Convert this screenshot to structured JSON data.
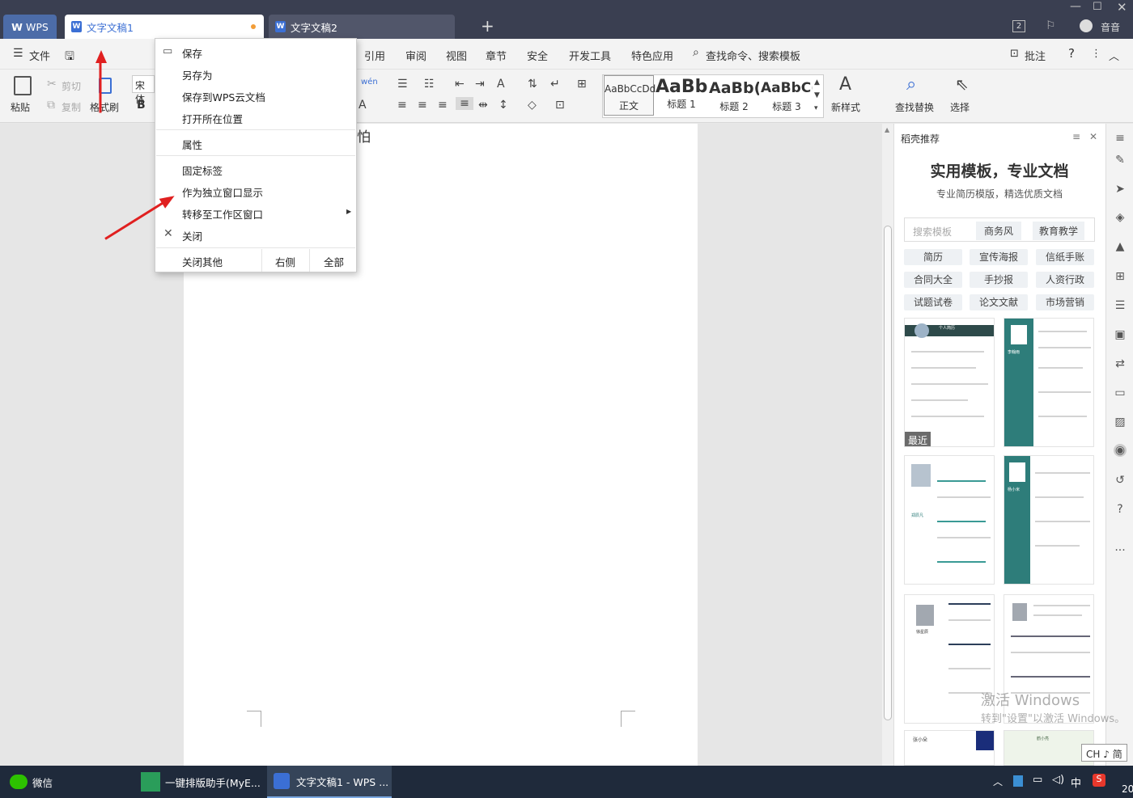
{
  "titlebar": {
    "wps_tab": "WPS",
    "tabs": [
      {
        "label": "文字文稿1"
      },
      {
        "label": "文字文稿2"
      }
    ],
    "new_tab": "+",
    "badge": "2",
    "user_name": "音音"
  },
  "menubar": {
    "items": [
      "文件",
      "引用",
      "审阅",
      "视图",
      "章节",
      "安全",
      "开发工具",
      "特色应用"
    ],
    "search": "查找命令、搜索模板",
    "comment": "批注",
    "help": "?"
  },
  "ribbon": {
    "paste": "粘贴",
    "cut": "剪切",
    "copy": "复制",
    "format_painter": "格式刷",
    "font": "宋体",
    "bold": "B",
    "phonetic": "wén",
    "styles": [
      {
        "preview": "AaBbCcDd",
        "label": "正文"
      },
      {
        "preview": "AaBb",
        "label": "标题 1"
      },
      {
        "preview": "AaBb(",
        "label": "标题 2"
      },
      {
        "preview": "AaBbC(",
        "label": "标题 3"
      }
    ],
    "new_style": "新样式",
    "find_replace": "查找替换",
    "select": "选择"
  },
  "document": {
    "visible_text": "怕"
  },
  "context_menu": {
    "items": [
      "保存",
      "另存为",
      "保存到WPS云文档",
      "打开所在位置",
      "属性",
      "固定标签",
      "作为独立窗口显示",
      "转移至工作区窗口",
      "关闭"
    ],
    "close_others": "关闭其他",
    "right_side": "右侧",
    "all": "全部"
  },
  "panel": {
    "title": "稻壳推荐",
    "headline": "实用模板，专业文档",
    "subline": "专业简历模版，精选优质文档",
    "search_placeholder": "搜索模板",
    "search_tags": [
      "商务风",
      "教育教学"
    ],
    "categories": [
      "简历",
      "宣传海报",
      "信纸手账",
      "合同大全",
      "手抄报",
      "人资行政",
      "试题试卷",
      "论文文献",
      "市场营销"
    ],
    "recent_badge": "最近",
    "thumb_names": [
      "个人简历",
      "李翰雨",
      "郑辰凡",
      "杨小米",
      "徐星辰",
      "张小朵",
      "鹤小亮"
    ]
  },
  "watermark": {
    "line1": "激活 Windows",
    "line2": "转到\"设置\"以激活 Windows。"
  },
  "ime": {
    "label": "CH ♪ 简"
  },
  "taskbar": {
    "apps": [
      {
        "label": "微信"
      },
      {
        "label": "一键排版助手(MyE..."
      },
      {
        "label": "文字文稿1 - WPS ..."
      }
    ],
    "tray": [
      "中",
      "S"
    ],
    "clock": "20"
  },
  "colors": {
    "titlebar": "#3a3f51",
    "accent": "#3b6fd4",
    "arrow": "#e02020",
    "teal": "#2e7d7a",
    "taskbar": "#1f2a3b"
  }
}
